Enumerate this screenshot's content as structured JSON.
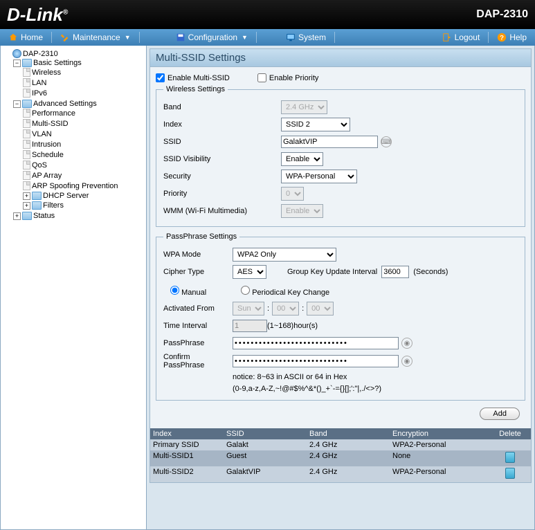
{
  "header": {
    "brand": "D-Link",
    "model": "DAP-2310"
  },
  "menubar": {
    "home": "Home",
    "maintenance": "Maintenance",
    "configuration": "Configuration",
    "system": "System",
    "logout": "Logout",
    "help": "Help"
  },
  "tree": {
    "root": "DAP-2310",
    "basic": "Basic Settings",
    "basic_items": {
      "wireless": "Wireless",
      "lan": "LAN",
      "ipv6": "IPv6"
    },
    "advanced": "Advanced Settings",
    "adv_items": {
      "performance": "Performance",
      "multissid": "Multi-SSID",
      "vlan": "VLAN",
      "intrusion": "Intrusion",
      "schedule": "Schedule",
      "qos": "QoS",
      "aparray": "AP Array",
      "arp": "ARP Spoofing Prevention",
      "dhcp": "DHCP Server",
      "filters": "Filters"
    },
    "status": "Status"
  },
  "panel": {
    "title": "Multi-SSID Settings",
    "enable_multi_label": "Enable Multi-SSID",
    "enable_multi_checked": true,
    "enable_priority_label": "Enable Priority",
    "enable_priority_checked": false,
    "ws_legend": "Wireless Settings",
    "ws": {
      "band_label": "Band",
      "band": "2.4 GHz",
      "index_label": "Index",
      "index": "SSID 2",
      "ssid_label": "SSID",
      "ssid": "GalaktVIP",
      "vis_label": "SSID Visibility",
      "vis": "Enable",
      "sec_label": "Security",
      "sec": "WPA-Personal",
      "prio_label": "Priority",
      "prio": "0",
      "wmm_label": "WMM (Wi-Fi Multimedia)",
      "wmm": "Enable"
    },
    "pp_legend": "PassPhrase Settings",
    "pp": {
      "mode_label": "WPA Mode",
      "mode": "WPA2 Only",
      "cipher_label": "Cipher Type",
      "cipher": "AES",
      "gkui_label": "Group Key Update Interval",
      "gkui": "3600",
      "gkui_unit": "(Seconds)",
      "manual_label": "Manual",
      "periodical_label": "Periodical Key Change",
      "actfrom_label": "Activated From",
      "actfrom_day": "Sun",
      "actfrom_h": "00",
      "actfrom_m": "00",
      "ti_label": "Time Interval",
      "ti": "1",
      "ti_unit": "(1~168)hour(s)",
      "pass_label": "PassPhrase",
      "cpass_label": "Confirm PassPhrase",
      "notice1": "notice: 8~63 in ASCII or 64 in Hex",
      "notice2": "(0-9,a-z,A-Z,~!@#$%^&*()_+`-={}[];':\"|,./<>?)",
      "add_btn": "Add"
    },
    "table": {
      "h_index": "Index",
      "h_ssid": "SSID",
      "h_band": "Band",
      "h_enc": "Encryption",
      "h_del": "Delete",
      "rows": [
        {
          "index": "Primary SSID",
          "ssid": "Galakt",
          "band": "2.4 GHz",
          "enc": "WPA2-Personal",
          "del": false
        },
        {
          "index": "Multi-SSID1",
          "ssid": "Guest",
          "band": "2.4 GHz",
          "enc": "None",
          "del": true,
          "sel": true
        },
        {
          "index": "Multi-SSID2",
          "ssid": "GalaktVIP",
          "band": "2.4 GHz",
          "enc": "WPA2-Personal",
          "del": true
        }
      ]
    }
  }
}
